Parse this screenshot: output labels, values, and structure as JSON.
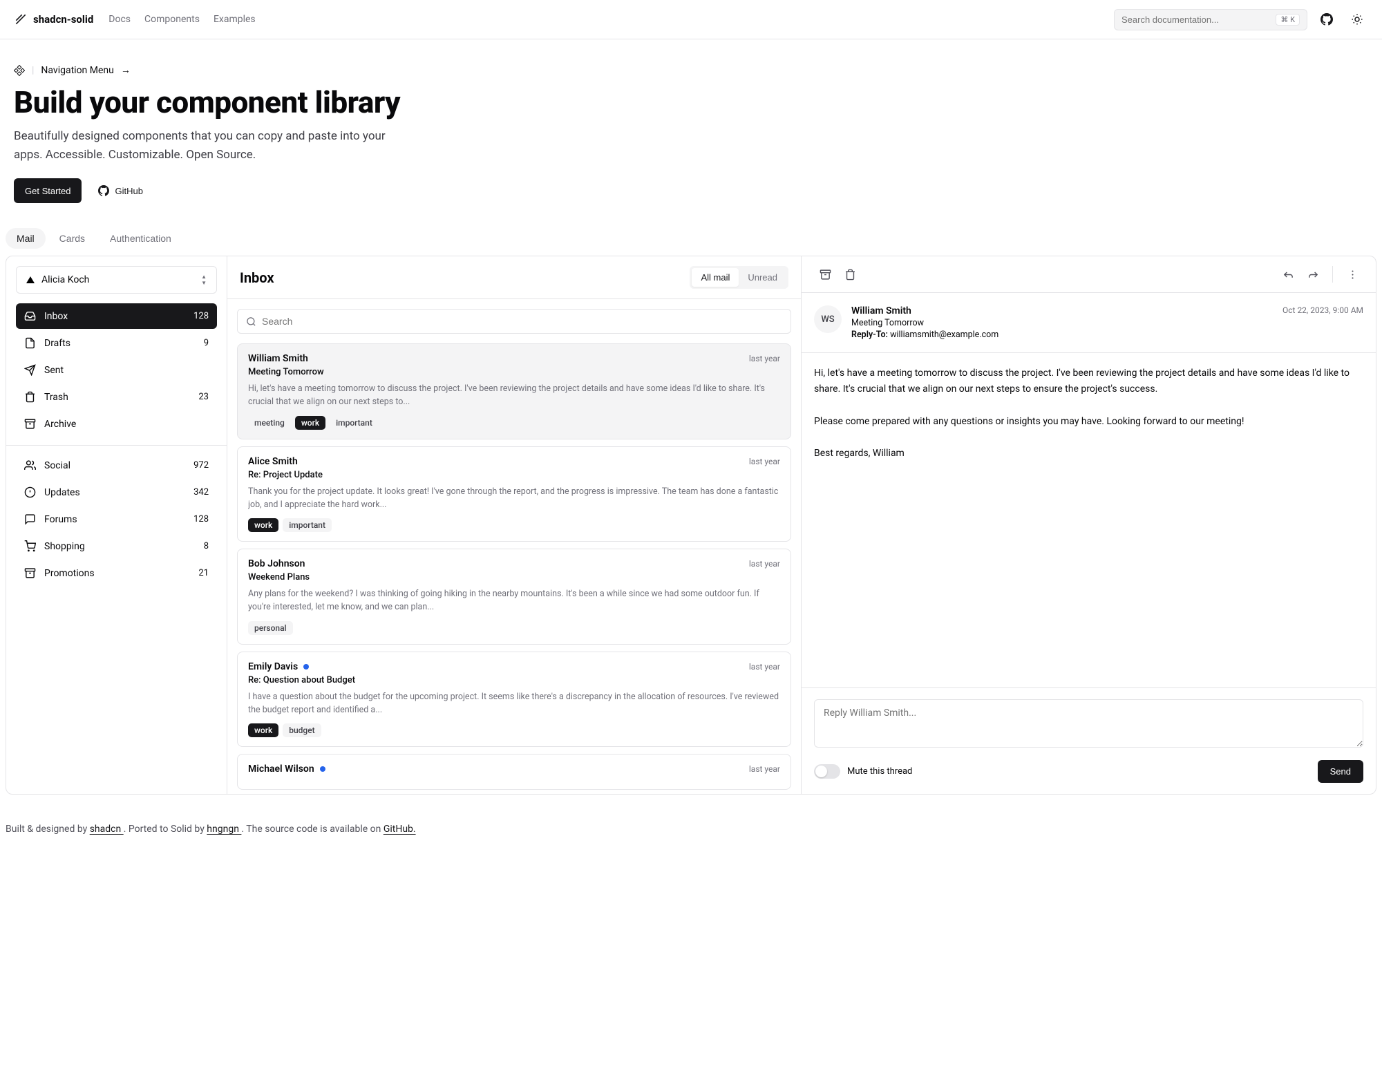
{
  "header": {
    "brand": "shadcn-solid",
    "nav": [
      "Docs",
      "Components",
      "Examples"
    ],
    "search_placeholder": "Search documentation...",
    "kbd": "⌘ K"
  },
  "hero": {
    "breadcrumb": "Navigation Menu",
    "arrow": "→",
    "title": "Build your component library",
    "subtitle": "Beautifully designed components that you can copy and paste into your apps. Accessible. Customizable. Open Source.",
    "cta_primary": "Get Started",
    "cta_secondary": "GitHub"
  },
  "tabs": [
    "Mail",
    "Cards",
    "Authentication"
  ],
  "account": "Alicia Koch",
  "folders_primary": [
    {
      "icon": "inbox",
      "label": "Inbox",
      "count": "128",
      "active": true
    },
    {
      "icon": "file",
      "label": "Drafts",
      "count": "9"
    },
    {
      "icon": "send",
      "label": "Sent",
      "count": ""
    },
    {
      "icon": "trash",
      "label": "Trash",
      "count": "23"
    },
    {
      "icon": "archive",
      "label": "Archive",
      "count": ""
    }
  ],
  "folders_secondary": [
    {
      "icon": "users",
      "label": "Social",
      "count": "972"
    },
    {
      "icon": "alert",
      "label": "Updates",
      "count": "342"
    },
    {
      "icon": "chat",
      "label": "Forums",
      "count": "128"
    },
    {
      "icon": "cart",
      "label": "Shopping",
      "count": "8"
    },
    {
      "icon": "archive",
      "label": "Promotions",
      "count": "21"
    }
  ],
  "list": {
    "title": "Inbox",
    "filter_all": "All mail",
    "filter_unread": "Unread",
    "search_placeholder": "Search"
  },
  "messages": [
    {
      "from": "William Smith",
      "time": "last year",
      "subject": "Meeting Tomorrow",
      "preview": "Hi, let's have a meeting tomorrow to discuss the project. I've been reviewing the project details and have some ideas I'd like to share. It's crucial that we align on our next steps to...",
      "tags": [
        {
          "t": "meeting"
        },
        {
          "t": "work",
          "dk": true
        },
        {
          "t": "important"
        }
      ],
      "selected": true,
      "unread": false
    },
    {
      "from": "Alice Smith",
      "time": "last year",
      "subject": "Re: Project Update",
      "preview": "Thank you for the project update. It looks great! I've gone through the report, and the progress is impressive. The team has done a fantastic job, and I appreciate the hard work...",
      "tags": [
        {
          "t": "work",
          "dk": true
        },
        {
          "t": "important"
        }
      ],
      "unread": false
    },
    {
      "from": "Bob Johnson",
      "time": "last year",
      "subject": "Weekend Plans",
      "preview": "Any plans for the weekend? I was thinking of going hiking in the nearby mountains. It's been a while since we had some outdoor fun. If you're interested, let me know, and we can plan...",
      "tags": [
        {
          "t": "personal"
        }
      ],
      "unread": false
    },
    {
      "from": "Emily Davis",
      "time": "last year",
      "subject": "Re: Question about Budget",
      "preview": "I have a question about the budget for the upcoming project. It seems like there's a discrepancy in the allocation of resources. I've reviewed the budget report and identified a...",
      "tags": [
        {
          "t": "work",
          "dk": true
        },
        {
          "t": "budget"
        }
      ],
      "unread": true
    },
    {
      "from": "Michael Wilson",
      "time": "last year",
      "subject": "",
      "preview": "",
      "tags": [],
      "unread": true
    }
  ],
  "detail": {
    "initials": "WS",
    "name": "William Smith",
    "subject": "Meeting Tomorrow",
    "reply_to_label": "Reply-To:",
    "reply_to": "williamsmith@example.com",
    "date": "Oct 22, 2023, 9:00 AM",
    "body": "Hi, let's have a meeting tomorrow to discuss the project. I've been reviewing the project details and have some ideas I'd like to share. It's crucial that we align on our next steps to ensure the project's success.\n\nPlease come prepared with any questions or insights you may have. Looking forward to our meeting!\n\nBest regards, William",
    "reply_placeholder": "Reply William Smith...",
    "mute_label": "Mute this thread",
    "send": "Send"
  },
  "footer": {
    "p1": "Built & designed by ",
    "a1": "shadcn ",
    "p2": ". Ported to Solid by ",
    "a2": "hngngn ",
    "p3": ". The source code is available on ",
    "a3": "GitHub."
  }
}
